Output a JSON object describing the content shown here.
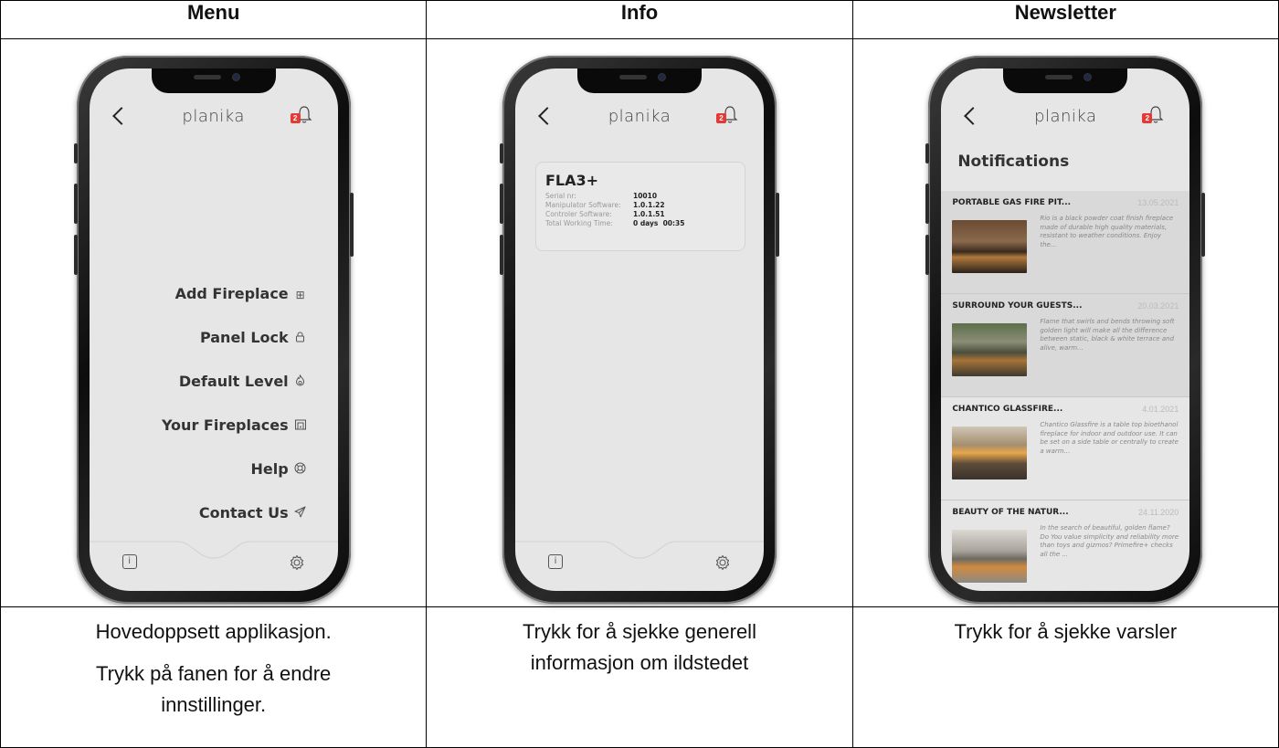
{
  "columns": {
    "menu": "Menu",
    "info": "Info",
    "newsletter": "Newsletter"
  },
  "app": {
    "brand": "planika",
    "badge_count": "2"
  },
  "menu_screen": {
    "items": [
      {
        "label": "Add Fireplace",
        "icon": "plus-square-icon"
      },
      {
        "label": "Panel Lock",
        "icon": "lock-icon"
      },
      {
        "label": "Default Level",
        "icon": "flame-icon"
      },
      {
        "label": "Your Fireplaces",
        "icon": "fireplace-icon"
      },
      {
        "label": "Help",
        "icon": "lifebuoy-icon"
      },
      {
        "label": "Contact Us",
        "icon": "send-icon"
      }
    ],
    "info_glyph": "i"
  },
  "info_screen": {
    "model": "FLA3+",
    "rows": [
      {
        "key": "Serial nr:",
        "value": "10010"
      },
      {
        "key": "Manipulator Software:",
        "value": "1.0.1.22"
      },
      {
        "key": "Controler Software:",
        "value": "1.0.1.51"
      },
      {
        "key": "Total Working Time:",
        "value": "0 days  00:35"
      }
    ]
  },
  "newsletter_screen": {
    "title": "Notifications",
    "items": [
      {
        "name": "PORTABLE GAS FIRE PIT...",
        "date": "13.05.2021",
        "text": "Rio is a black powder coat finish fireplace made of durable high quality materials, resistant to weather conditions. Enjoy the..."
      },
      {
        "name": "SURROUND YOUR GUESTS...",
        "date": "20.03.2021",
        "text": "Flame that swirls and bends throwing soft golden light will make all the difference between static, black & white terrace and alive, warm..."
      },
      {
        "name": "CHANTICO GLASSFIRE...",
        "date": "4.01.2021",
        "text": "Chantico Glassfire is a table top bioethanol fireplace for indoor and outdoor use. It can be set on a side table or centrally to create a warm..."
      },
      {
        "name": "BEAUTY OF THE NATUR...",
        "date": "24.11.2020",
        "text": "In the search of beautiful, golden flame? Do You value simplicity and reliability more than toys and gizmos? Primefire+ checks all the ..."
      }
    ]
  },
  "captions": {
    "menu_line1": "Hovedoppsett applikasjon.",
    "menu_line2": "Trykk på fanen for å endre innstillinger.",
    "info": "Trykk for å sjekke generell informasjon om ildstedet",
    "newsletter": "Trykk for å sjekke varsler"
  }
}
